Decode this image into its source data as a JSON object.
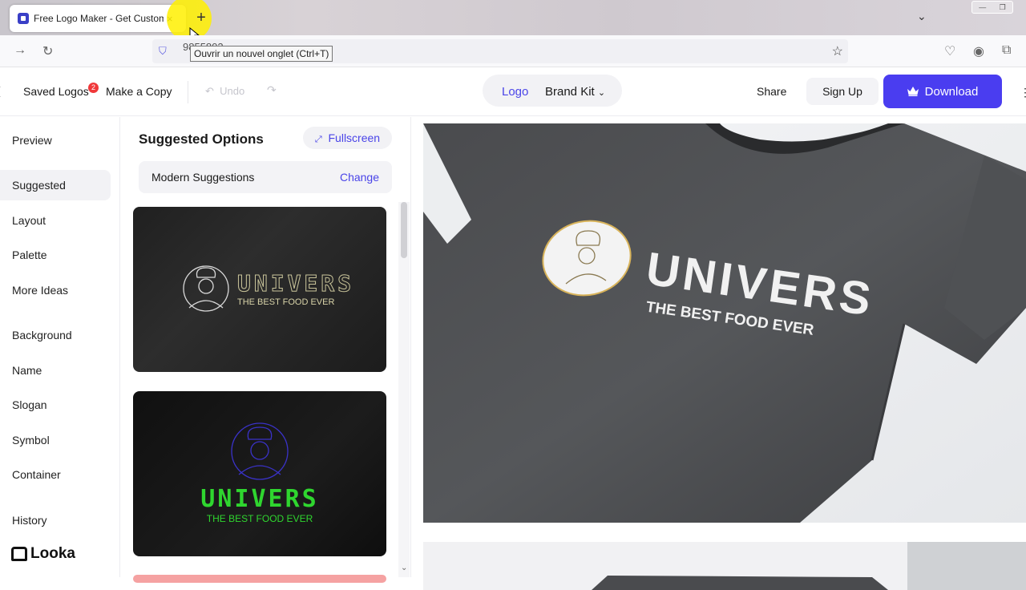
{
  "browser": {
    "tab_title": "Free Logo Maker - Get Custom",
    "tab_close": "×",
    "new_tab": "+",
    "tooltip": "Ouvrir un nouvel onglet (Ctrl+T)",
    "url_fragment": "9855802"
  },
  "header": {
    "saved_logos": "Saved Logos",
    "saved_badge": "2",
    "make_copy": "Make a Copy",
    "undo": "Undo",
    "seg_logo": "Logo",
    "seg_brand_kit": "Brand Kit",
    "share": "Share",
    "sign_up": "Sign Up",
    "download": "Download"
  },
  "sidebar": {
    "items": [
      {
        "label": "Preview"
      },
      {
        "label": "Suggested"
      },
      {
        "label": "Layout"
      },
      {
        "label": "Palette"
      },
      {
        "label": "More Ideas"
      },
      {
        "label": "Background"
      },
      {
        "label": "Name"
      },
      {
        "label": "Slogan"
      },
      {
        "label": "Symbol"
      },
      {
        "label": "Container"
      },
      {
        "label": "History"
      }
    ],
    "brand": "Looka"
  },
  "panel": {
    "title": "Suggested Options",
    "fullscreen": "Fullscreen",
    "suggestion_set": "Modern Suggestions",
    "change": "Change",
    "cards": [
      {
        "name": "UNIVERS",
        "slogan": "THE BEST FOOD EVER",
        "name_color": "#c9c49a",
        "slogan_color": "#d8d3a8",
        "icon_color": "#d9d9d9"
      },
      {
        "name": "UNIVERS",
        "slogan": "THE BEST FOOD EVER",
        "name_color": "#2fd62f",
        "slogan_color": "#2fd62f",
        "icon_color": "#3a32c8"
      }
    ]
  },
  "mockup": {
    "name": "UNIVERS",
    "slogan": "THE BEST FOOD EVER"
  },
  "colors": {
    "accent": "#4a3df0",
    "badge": "#f0383a"
  }
}
